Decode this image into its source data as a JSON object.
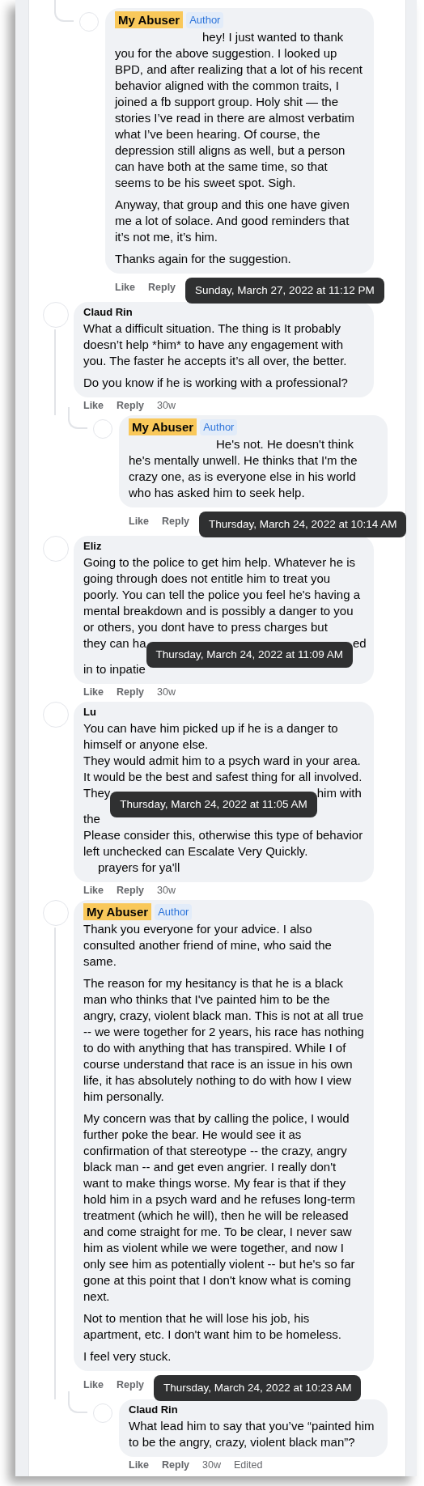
{
  "comments": [
    {
      "kind": "reply",
      "name": "My Abuser",
      "highlighted": true,
      "badge": "Author",
      "body": [
        {
          "kind": "indented_para",
          "text": "hey! I just wanted to thank you for the above suggestion. I looked up BPD, and after realizing that a lot of his recent behavior aligned with the common traits, I joined a fb support group. Holy shit — the stories I’ve read in there are almost verbatim what I’ve been hearing. Of course, the depression still aligns as well, but a person can have both at the same time, so that seems to be his sweet spot. Sigh."
        },
        {
          "kind": "para",
          "text": "Anyway, that group and this one have given me a lot of solace. And good reminders that it’s not me, it’s him."
        },
        {
          "kind": "para",
          "text": "Thanks again for the suggestion."
        }
      ],
      "actions": {
        "like": "Like",
        "reply": "Reply",
        "tooltip": "Sunday, March 27, 2022 at 11:12 PM"
      }
    },
    {
      "kind": "top",
      "name": "Claud Rin",
      "highlighted": false,
      "body": [
        {
          "kind": "para",
          "text": "What a difficult situation. The thing is It probably doesn’t help *him* to have any engagement with you. The faster he accepts it’s all over, the better."
        },
        {
          "kind": "para",
          "text": "Do you know if he is working with a professional?"
        }
      ],
      "actions": {
        "like": "Like",
        "reply": "Reply",
        "age": "30w"
      },
      "children": [
        {
          "kind": "reply",
          "name": "My Abuser",
          "highlighted": true,
          "badge": "Author",
          "body": [
            {
              "kind": "indented_para",
              "text": "He's not. He doesn't think he's mentally unwell. He thinks that I'm the crazy one, as is everyone else in his world who has asked him to seek help."
            }
          ],
          "actions": {
            "like": "Like",
            "reply": "Reply",
            "tooltip": "Thursday, March 24, 2022 at 10:14 AM"
          }
        }
      ]
    },
    {
      "kind": "top",
      "name": "Eliz",
      "highlighted": false,
      "body": [
        {
          "kind": "line",
          "text": "Going to the police to get him help. Whatever he is going through does not entitle him to treat you poorly. You can tell the police you feel he's having a mental breakdown and is possibly a danger to you or others, you dont have to press charges but"
        },
        {
          "kind": "cut",
          "left": "they can ha",
          "tooltip": "Thursday, March 24, 2022 at 11:09 AM",
          "right": "ed"
        },
        {
          "kind": "line",
          "text": "in to inpatie"
        }
      ],
      "actions": {
        "like": "Like",
        "reply": "Reply",
        "age": "30w"
      }
    },
    {
      "kind": "top",
      "name": "Lu",
      "highlighted": false,
      "body": [
        {
          "kind": "line",
          "text": "You can have him picked up if he is a danger to himself or anyone else."
        },
        {
          "kind": "line",
          "text": "They would admit him to a psych ward in your area. It would be the best and safest thing for all involved."
        },
        {
          "kind": "cut",
          "left": "They",
          "tooltip": "Thursday, March 24, 2022 at 11:05 AM",
          "right": "him with"
        },
        {
          "kind": "line",
          "text": "the"
        },
        {
          "kind": "line",
          "text": "Please consider this, otherwise this type of behavior left unchecked can Escalate Very Quickly."
        },
        {
          "kind": "indented_line",
          "text": "prayers for ya'll"
        }
      ],
      "actions": {
        "like": "Like",
        "reply": "Reply",
        "age": "30w"
      }
    },
    {
      "kind": "top",
      "name": "My Abuser",
      "highlighted": true,
      "badge": "Author",
      "body": [
        {
          "kind": "para",
          "text": "Thank you everyone for your advice. I also consulted another friend of mine, who said the same."
        },
        {
          "kind": "para",
          "text": "The reason for my hesitancy is that he is a black man who thinks that I've painted him to be the angry, crazy, violent black man. This is not at all true -- we were together for 2 years, his race has nothing to do with anything that has transpired. While I of course understand that race is an issue in his own life, it has absolutely nothing to do with how I view him personally."
        },
        {
          "kind": "para",
          "text": "My concern was that by calling the police, I would further poke the bear. He would see it as confirmation of that stereotype -- the crazy, angry black man -- and get even angrier. I really don't want to make things worse. My fear is that if they hold him in a psych ward and he refuses long-term treatment (which he will), then he will be released and come straight for me. To be clear, I never saw him as violent while we were together, and now I only see him as potentially violent -- but he's so far gone at this point that I don't know what is coming next."
        },
        {
          "kind": "para",
          "text": "Not to mention that he will lose his job, his apartment, etc. I don't want him to be homeless."
        },
        {
          "kind": "para",
          "text": "I feel very stuck."
        }
      ],
      "actions": {
        "like": "Like",
        "reply": "Reply",
        "tooltip": "Thursday, March 24, 2022 at 10:23 AM"
      },
      "children": [
        {
          "kind": "reply",
          "name": "Claud Rin",
          "highlighted": false,
          "body": [
            {
              "kind": "para",
              "text": "What lead him to say that you’ve “painted him to be the angry, crazy, violent black man”?"
            }
          ],
          "actions": {
            "like": "Like",
            "reply": "Reply",
            "age": "30w",
            "edited": "Edited"
          }
        }
      ]
    }
  ]
}
